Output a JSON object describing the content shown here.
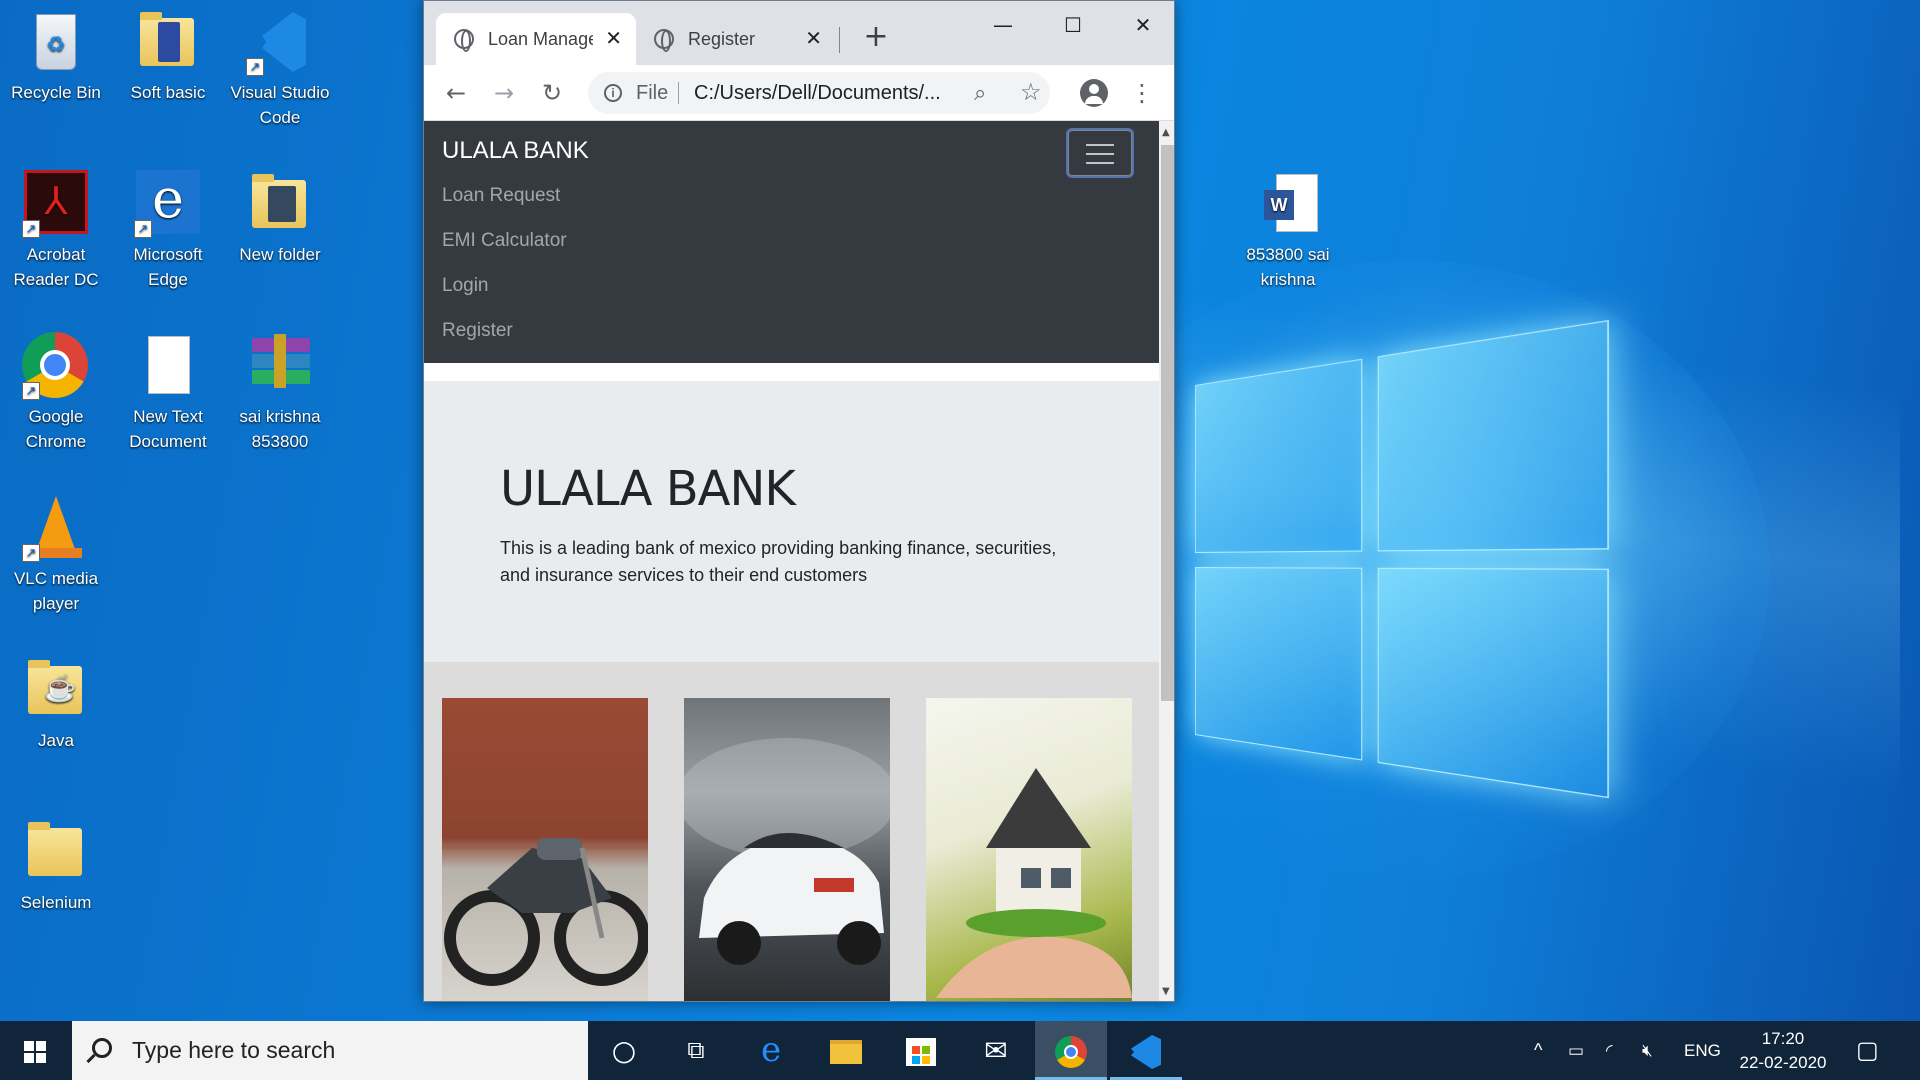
{
  "desktop": {
    "icons": [
      {
        "label": "Recycle Bin"
      },
      {
        "label": "Soft basic"
      },
      {
        "label": "Visual Studio Code"
      },
      {
        "label": "Acrobat Reader DC"
      },
      {
        "label": "Microsoft Edge"
      },
      {
        "label": "New folder"
      },
      {
        "label": "Google Chrome"
      },
      {
        "label": "New Text Document"
      },
      {
        "label": "sai krishna 853800"
      },
      {
        "label": "VLC media player"
      },
      {
        "label": "Java"
      },
      {
        "label": "Selenium"
      },
      {
        "label": "853800 sai krishna"
      }
    ]
  },
  "browser": {
    "tabs": [
      {
        "title": "Loan Management",
        "icon": "globe-icon",
        "active": true
      },
      {
        "title": "Register",
        "icon": "globe-icon",
        "active": false
      }
    ],
    "close_glyph": "✕",
    "new_tab_glyph": "+",
    "window_controls": {
      "minimize": "—",
      "maximize": "☐",
      "close": "✕"
    },
    "nav": {
      "back": "←",
      "forward": "→",
      "reload": "↻"
    },
    "omnibox": {
      "scheme_label": "File",
      "url": "C:/Users/Dell/Documents/...",
      "info_glyph": "i"
    },
    "menu_glyph": "⋮"
  },
  "page": {
    "brand": "ULALA BANK",
    "nav_links": [
      "Loan Request",
      "EMI Calculator",
      "Login",
      "Register"
    ],
    "jumbotron": {
      "heading": "ULALA BANK",
      "text": "This is a leading bank of mexico providing banking finance, securities, and insurance services to their end customers"
    },
    "cards": [
      {
        "image": "motorcycle"
      },
      {
        "image": "sports-car"
      },
      {
        "image": "house-in-hand"
      }
    ]
  },
  "taskbar": {
    "search_placeholder": "Type here to search",
    "tray": {
      "lang": "ENG",
      "chevron": "^"
    },
    "clock": {
      "time": "17:20",
      "date": "22-02-2020"
    }
  },
  "colors": {
    "navbar": "#343a40",
    "jumbotron": "#e9ecef",
    "taskbar": "#10243a",
    "desktop": "#0a78d2"
  }
}
